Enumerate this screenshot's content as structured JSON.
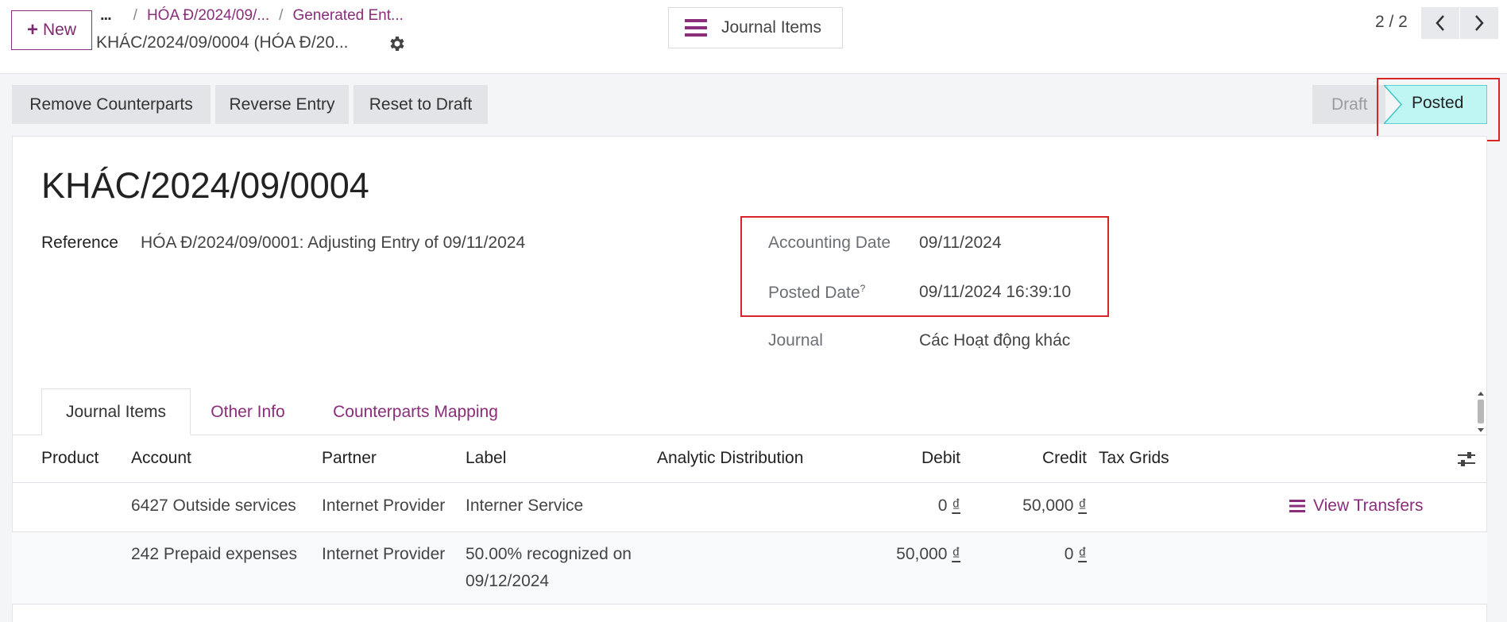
{
  "topbar": {
    "new_label": "New",
    "breadcrumb": {
      "more": "...",
      "separator": "/",
      "crumbs": [
        "HÓA Đ/2024/09/...",
        "Generated Ent..."
      ]
    },
    "record_title": "KHÁC/2024/09/0004 (HÓA Đ/20...",
    "center_button": "Journal Items",
    "pager": "2 / 2"
  },
  "actions": {
    "remove_counterparts": "Remove Counterparts",
    "reverse_entry": "Reverse Entry",
    "reset_to_draft": "Reset to Draft"
  },
  "status": {
    "draft": "Draft",
    "posted": "Posted"
  },
  "form": {
    "title": "KHÁC/2024/09/0004",
    "reference_label": "Reference",
    "reference_value": "HÓA Đ/2024/09/0001: Adjusting Entry of 09/11/2024",
    "accounting_date_label": "Accounting Date",
    "accounting_date_value": "09/11/2024",
    "posted_date_label": "Posted Date",
    "posted_date_help": "?",
    "posted_date_value": "09/11/2024 16:39:10",
    "journal_label": "Journal",
    "journal_value": "Các Hoạt động khác"
  },
  "tabs": [
    "Journal Items",
    "Other Info",
    "Counterparts Mapping"
  ],
  "table": {
    "columns": [
      "Product",
      "Account",
      "Partner",
      "Label",
      "Analytic Distribution",
      "Debit",
      "Credit",
      "Tax Grids"
    ],
    "currency_symbol": "₫",
    "rows": [
      {
        "product": "",
        "account": "6427 Outside services",
        "partner": "Internet Provider",
        "label": "Interner Service",
        "analytic": "",
        "debit": "0",
        "credit": "50,000",
        "action": "View Transfers"
      },
      {
        "product": "",
        "account": "242 Prepaid expenses",
        "partner": "Internet Provider",
        "label_line1": "50.00% recognized on",
        "label_line2": "09/12/2024",
        "analytic": "",
        "debit": "50,000",
        "credit": "0"
      }
    ]
  },
  "colors": {
    "brand": "#8a2d7a",
    "posted_bg": "#bff5f3",
    "posted_border": "#3cc7c4",
    "highlight": "#d9252a"
  }
}
